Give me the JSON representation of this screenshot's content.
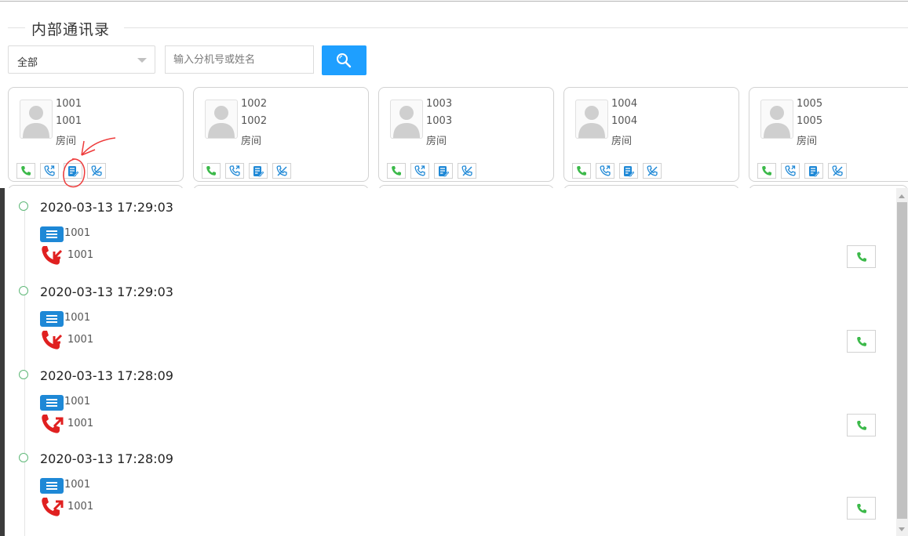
{
  "section": {
    "title": "内部通讯录"
  },
  "filter": {
    "selected": "全部"
  },
  "search": {
    "placeholder": "输入分机号或姓名"
  },
  "contacts": [
    {
      "line1": "1001",
      "line2": "1001",
      "room": "房间"
    },
    {
      "line1": "1002",
      "line2": "1002",
      "room": "房间"
    },
    {
      "line1": "1003",
      "line2": "1003",
      "room": "房间"
    },
    {
      "line1": "1004",
      "line2": "1004",
      "room": "房间"
    },
    {
      "line1": "1005",
      "line2": "1005",
      "room": "房间"
    }
  ],
  "call_history": [
    {
      "time": "2020-03-13 17:29:03",
      "extension": "1001",
      "number": "1001",
      "direction": "incoming"
    },
    {
      "time": "2020-03-13 17:29:03",
      "extension": "1001",
      "number": "1001",
      "direction": "incoming"
    },
    {
      "time": "2020-03-13 17:28:09",
      "extension": "1001",
      "number": "1001",
      "direction": "outgoing"
    },
    {
      "time": "2020-03-13 17:28:09",
      "extension": "1001",
      "number": "1001",
      "direction": "outgoing"
    }
  ],
  "colors": {
    "accent": "#1e9fff",
    "call_green": "#3cb94a",
    "history_red": "#e02020",
    "badge_blue": "#1e88d6"
  },
  "icons": [
    "search-icon",
    "phone-icon",
    "callback-icon",
    "history-icon",
    "transfer-icon",
    "avatar-icon",
    "list-icon",
    "incoming-call-icon",
    "outgoing-call-icon"
  ]
}
